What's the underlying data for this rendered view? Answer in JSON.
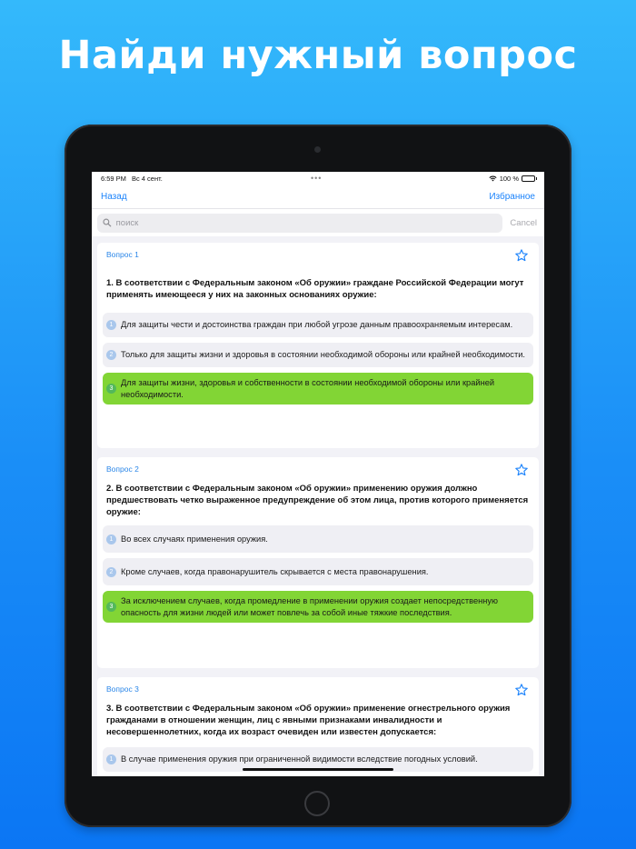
{
  "headline": "Найди нужный вопрос",
  "status": {
    "time": "6:59 PM",
    "date": "Вс 4 сент.",
    "dots": "•••",
    "battery": "100 %"
  },
  "nav": {
    "back": "Назад",
    "favorites": "Избранное"
  },
  "search": {
    "placeholder": "поиск",
    "cancel": "Cancel"
  },
  "questions": [
    {
      "label": "Вопрос 1",
      "text": "1. В соответствии с Федеральным законом «Об оружии» граждане Российской Федерации могут применять имеющееся у них на законных основаниях оружие:",
      "answers": [
        {
          "n": "1",
          "text": "Для защиты чести и достоинства граждан при любой угрозе данным правоохраняемым интересам.",
          "correct": false
        },
        {
          "n": "2",
          "text": "Только для защиты жизни и здоровья в состоянии необходимой обороны или крайней необходимости.",
          "correct": false
        },
        {
          "n": "3",
          "text": "Для защиты жизни, здоровья и собственности в состоянии необходимой обороны или крайней необходимости.",
          "correct": true
        }
      ]
    },
    {
      "label": "Вопрос 2",
      "text": "2. В соответствии с Федеральным законом «Об оружии» применению оружия должно предшествовать четко выраженное предупреждение об этом лица, против которого применяется оружие:",
      "answers": [
        {
          "n": "1",
          "text": "Во всех случаях применения оружия.",
          "correct": false
        },
        {
          "n": "2",
          "text": "Кроме случаев, когда правонарушитель скрывается с места правонарушения.",
          "correct": false
        },
        {
          "n": "3",
          "text": "За исключением случаев, когда промедление в применении оружия создает непосредственную опасность для жизни людей или может повлечь за собой иные тяжкие последствия.",
          "correct": true
        }
      ]
    },
    {
      "label": "Вопрос 3",
      "text": "3. В соответствии с Федеральным законом «Об оружии» применение огнестрельного оружия гражданами в отношении женщин, лиц с явными признаками инвалидности и несовершеннолетних, когда их возраст очевиден или известен допускается:",
      "answers": [
        {
          "n": "1",
          "text": "В случае применения оружия при ограниченной видимости вследствие погодных условий.",
          "correct": false
        }
      ]
    }
  ],
  "colors": {
    "accent": "#1a82fb",
    "correct": "#82d535",
    "background_top": "#34b9fb",
    "background_bottom": "#0b76f4"
  },
  "icons": {
    "star": "star-outline-icon",
    "search": "magnifier-icon",
    "wifi": "wifi-icon",
    "battery": "battery-icon"
  }
}
